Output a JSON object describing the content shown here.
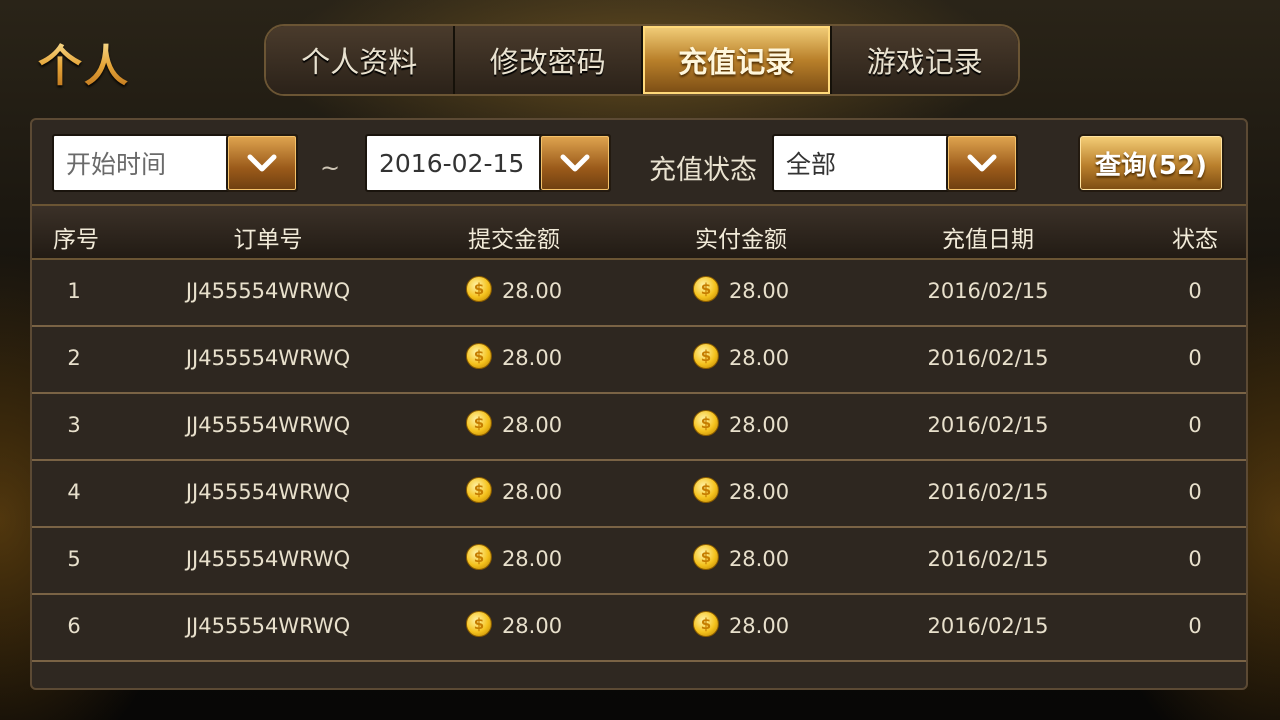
{
  "page": {
    "title": "个人"
  },
  "tabs": [
    {
      "label": "个人资料",
      "active": false
    },
    {
      "label": "修改密码",
      "active": false
    },
    {
      "label": "充值记录",
      "active": true
    },
    {
      "label": "游戏记录",
      "active": false
    }
  ],
  "filters": {
    "start_date": {
      "placeholder": "开始时间",
      "value": ""
    },
    "separator": "~",
    "end_date": {
      "value": "2016-02-15"
    },
    "status_label": "充值状态",
    "status": {
      "value": "全部"
    },
    "query_button": "查询(52)"
  },
  "table": {
    "columns": [
      "序号",
      "订单号",
      "提交金额",
      "实付金额",
      "充值日期",
      "状态"
    ],
    "rows": [
      {
        "no": "1",
        "order": "JJ455554WRWQ",
        "submitted": "28.00",
        "paid": "28.00",
        "date": "2016/02/15",
        "status": "0"
      },
      {
        "no": "2",
        "order": "JJ455554WRWQ",
        "submitted": "28.00",
        "paid": "28.00",
        "date": "2016/02/15",
        "status": "0"
      },
      {
        "no": "3",
        "order": "JJ455554WRWQ",
        "submitted": "28.00",
        "paid": "28.00",
        "date": "2016/02/15",
        "status": "0"
      },
      {
        "no": "4",
        "order": "JJ455554WRWQ",
        "submitted": "28.00",
        "paid": "28.00",
        "date": "2016/02/15",
        "status": "0"
      },
      {
        "no": "5",
        "order": "JJ455554WRWQ",
        "submitted": "28.00",
        "paid": "28.00",
        "date": "2016/02/15",
        "status": "0"
      },
      {
        "no": "6",
        "order": "JJ455554WRWQ",
        "submitted": "28.00",
        "paid": "28.00",
        "date": "2016/02/15",
        "status": "0"
      }
    ]
  },
  "icons": {
    "dropdown": "chevron-down-icon",
    "coin": "gold-coin-icon"
  },
  "colors": {
    "accent_gold": "#d9a041",
    "panel_bg": "#2f2821",
    "row_divider": "#7a6345"
  }
}
